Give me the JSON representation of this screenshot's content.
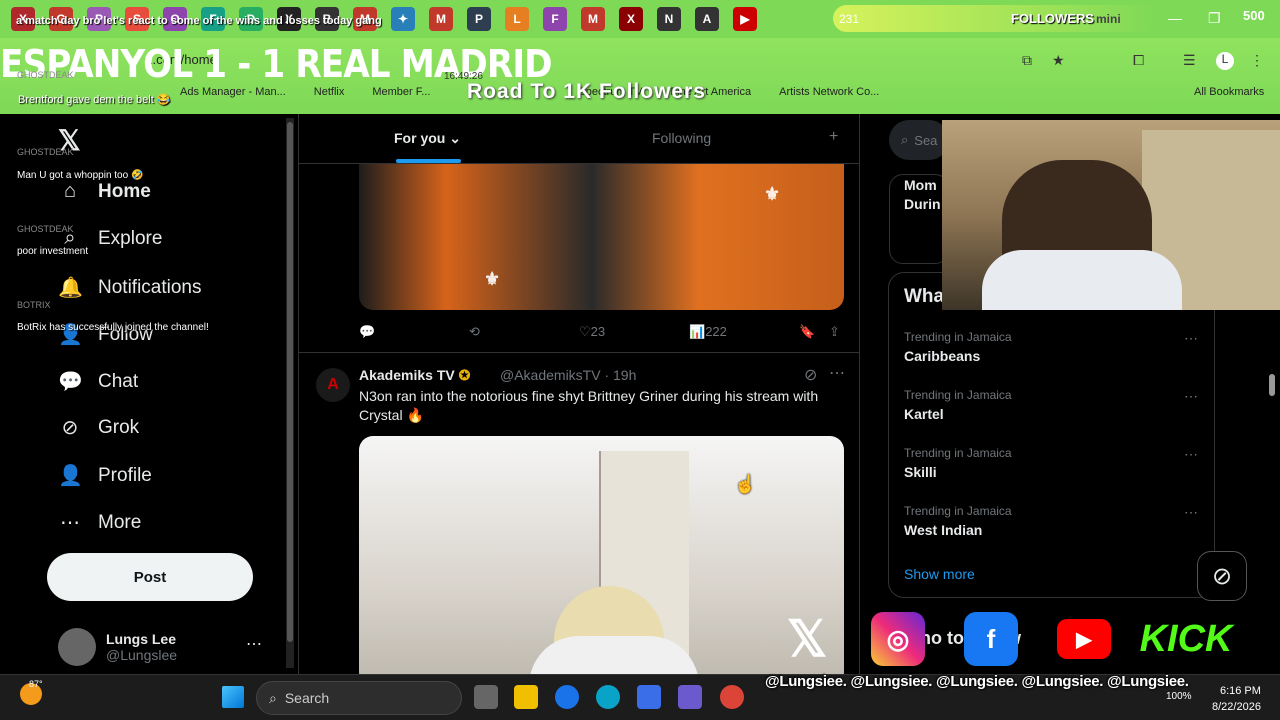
{
  "ticker": "a match day bro let's react to some of the wins and losses today gang",
  "tabs": [
    "X",
    "G",
    "P",
    "S",
    "O",
    "F",
    "D",
    "X",
    "B",
    "M",
    "✦",
    "M",
    "P",
    "L",
    "F",
    "M",
    "X",
    "N",
    "A",
    "▶"
  ],
  "follow_goal": {
    "current": "231",
    "label": "FOLLOWERS",
    "mini": "mini",
    "target": "500"
  },
  "window_controls": {
    "minimize": "—",
    "restore": "❐",
    "close": "✕"
  },
  "headline": "ESPANYOL 1 - 1 REAL MADRID",
  "url": "x.com/home",
  "clock_overlay": "16:49:26",
  "overlay_road": "Road To 1K Followers",
  "bookmarks": [
    "Ads Manager - Man...",
    "Netflix",
    "Member F...",
    "Spectrum TV",
    "Fine Art America",
    "Artists Network Co..."
  ],
  "all_bookmarks": "All Bookmarks",
  "chat": [
    {
      "user": "GHOSTDEAK",
      "msg": "Brentford gave dem the belt 😂"
    },
    {
      "user": "GHOSTDEAK",
      "msg": "Man U got a whoppin too 🤣"
    },
    {
      "user": "GHOSTDEAK",
      "msg": "poor investment"
    },
    {
      "user": "BOTRIX",
      "msg": "BotRix has successfully joined the channel!"
    }
  ],
  "nav": {
    "items": [
      {
        "label": "Home",
        "icon": "⌂"
      },
      {
        "label": "Explore",
        "icon": "⌕"
      },
      {
        "label": "Notifications",
        "icon": "🔔"
      },
      {
        "label": "Follow",
        "icon": "👤"
      },
      {
        "label": "Chat",
        "icon": "💬"
      },
      {
        "label": "Grok",
        "icon": "⊘"
      },
      {
        "label": "Profile",
        "icon": "👤"
      },
      {
        "label": "More",
        "icon": "⋯"
      }
    ],
    "post_label": "Post",
    "account": {
      "name": "Lungs Lee",
      "handle": "@Lungslee"
    }
  },
  "feed": {
    "tabs": {
      "for_you": "For you",
      "following": "Following"
    },
    "post1": {
      "likes": "23",
      "views": "222"
    },
    "post2": {
      "author": "Akademiks TV",
      "handle_time": "@AkademiksTV · 19h",
      "text": "N3on ran into the notorious fine shyt Brittney Griner during his stream with Crystal 🔥"
    }
  },
  "right": {
    "search_placeholder": "Sea",
    "mom_text": "Mom\nDurin",
    "whats": "Wha",
    "trends": [
      {
        "context": "Trending in Jamaica",
        "name": "Caribbeans"
      },
      {
        "context": "Trending in Jamaica",
        "name": "Kartel"
      },
      {
        "context": "Trending in Jamaica",
        "name": "Skilli"
      },
      {
        "context": "Trending in Jamaica",
        "name": "West Indian"
      }
    ],
    "show_more": "Show more"
  },
  "social": {
    "howto": "ho to follow",
    "handles": "@Lungsiee. @Lungsiee. @Lungsiee. @Lungsiee. @Lungsiee.",
    "kick": "KICK"
  },
  "taskbar": {
    "weather": "87°",
    "search": "Search",
    "time": "6:16 PM",
    "date": "8/22/2026",
    "battery": "100%"
  },
  "colors": {
    "accent": "#1d9bf0",
    "overlay_green": "#7ed957",
    "bg": "#000000"
  }
}
